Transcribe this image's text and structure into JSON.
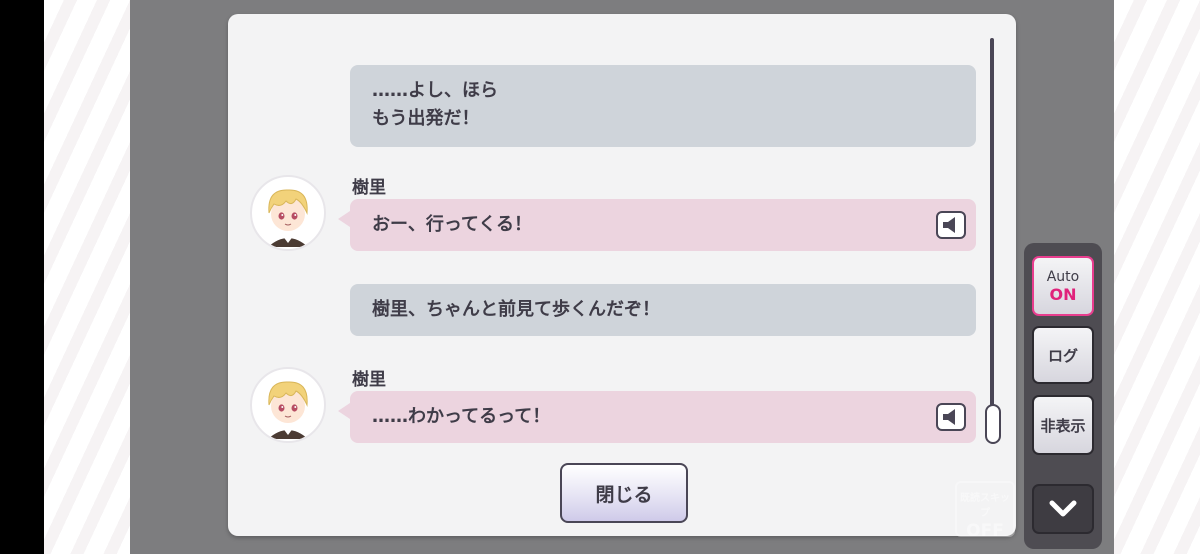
{
  "dialogue": {
    "entries": [
      {
        "type": "narration",
        "text1": "……よし、ほら",
        "text2": "もう出発だ！"
      },
      {
        "type": "speech",
        "speaker": "樹里",
        "text": "おー、行ってくる！",
        "icon": "speaker-icon"
      },
      {
        "type": "narration",
        "text": "樹里、ちゃんと前見て歩くんだぞ！"
      },
      {
        "type": "speech",
        "speaker": "樹里",
        "text": "……わかってるって！",
        "icon": "speaker-icon"
      }
    ]
  },
  "close_button": {
    "label": "閉じる"
  },
  "side_controls": {
    "auto_label": "Auto",
    "auto_state": "ON",
    "log_label": "ログ",
    "hide_label": "非表示",
    "down_icon": "chevron-down-icon"
  },
  "skip": {
    "label": "既読スキップ",
    "state": "OFF"
  },
  "colors": {
    "narration_bubble": "#cfd4da",
    "speech_bubble": "#ecd4df",
    "accent_on": "#e0227b",
    "text": "#3f3c48"
  }
}
